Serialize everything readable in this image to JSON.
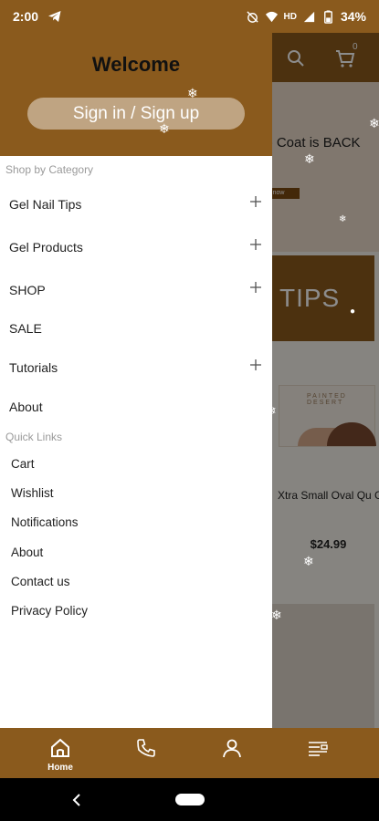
{
  "status_bar": {
    "time": "2:00",
    "battery": "34%",
    "network": "HD"
  },
  "background_page": {
    "banner_text": "op Coat is BACK",
    "banner_button": "now",
    "tips_label": "TIPS",
    "product_image_text": "PAINTED DESERT",
    "product_name": "Xtra Small Oval Qu Gel Tips",
    "product_price": "$24.99"
  },
  "drawer": {
    "welcome": "Welcome",
    "sign_in_label": "Sign in / Sign up",
    "shop_by_category_label": "Shop by Category",
    "categories": [
      {
        "label": "Gel Nail Tips",
        "expandable": true
      },
      {
        "label": "Gel Products",
        "expandable": true
      },
      {
        "label": "SHOP",
        "expandable": true
      },
      {
        "label": "SALE",
        "expandable": false
      },
      {
        "label": "Tutorials",
        "expandable": true
      },
      {
        "label": "About",
        "expandable": false
      }
    ],
    "quick_links_label": "Quick Links",
    "quick_links": [
      "Cart",
      "Wishlist",
      "Notifications",
      "About",
      "Contact us",
      "Privacy Policy"
    ]
  },
  "bottom_nav": {
    "home_label": "Home",
    "items": [
      "home-icon",
      "phone-icon",
      "user-icon",
      "menu-list-icon"
    ]
  },
  "colors": {
    "brand": "#8a5a1d",
    "drawer_bg": "#ffffff"
  }
}
